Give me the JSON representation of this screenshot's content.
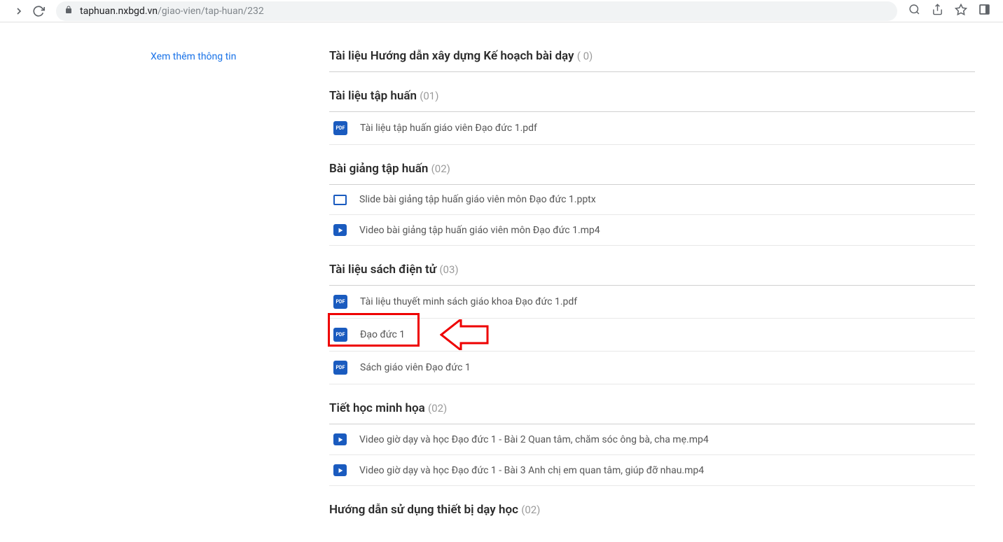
{
  "browser": {
    "url_domain": "taphuan.nxbgd.vn",
    "url_path": "/giao-vien/tap-huan/232"
  },
  "sidebar": {
    "more_info": "Xem thêm thông tin"
  },
  "sections": [
    {
      "title": "Tài liệu Hướng dẫn xây dựng Kế hoạch bài dạy",
      "count": "( 0)",
      "items": []
    },
    {
      "title": "Tài liệu tập huấn",
      "count": "(01)",
      "items": [
        {
          "icon": "pdf",
          "name": "Tài liệu tập huấn giáo viên Đạo đức 1.pdf"
        }
      ]
    },
    {
      "title": "Bài giảng tập huấn",
      "count": "(02)",
      "items": [
        {
          "icon": "pptx",
          "name": "Slide bài giảng tập huấn giáo viên môn Đạo đức 1.pptx"
        },
        {
          "icon": "video",
          "name": "Video bài giảng tập huấn giáo viên môn Đạo đức 1.mp4"
        }
      ]
    },
    {
      "title": "Tài liệu sách điện tử",
      "count": "(03)",
      "items": [
        {
          "icon": "pdf",
          "name": "Tài liệu thuyết minh sách giáo khoa Đạo đức 1.pdf"
        },
        {
          "icon": "pdf",
          "name": "Đạo đức 1"
        },
        {
          "icon": "pdf",
          "name": "Sách giáo viên Đạo đức 1"
        }
      ]
    },
    {
      "title": "Tiết học minh họa",
      "count": "(02)",
      "items": [
        {
          "icon": "video",
          "name": "Video giờ dạy và học Đạo đức 1 - Bài 2 Quan tâm, chăm sóc ông bà, cha mẹ.mp4"
        },
        {
          "icon": "video",
          "name": "Video giờ dạy và học Đạo đức 1 - Bài 3 Anh chị em quan tâm, giúp đỡ nhau.mp4"
        }
      ]
    },
    {
      "title": "Hướng dẫn sử dụng thiết bị dạy học",
      "count": "(02)",
      "items": []
    }
  ]
}
